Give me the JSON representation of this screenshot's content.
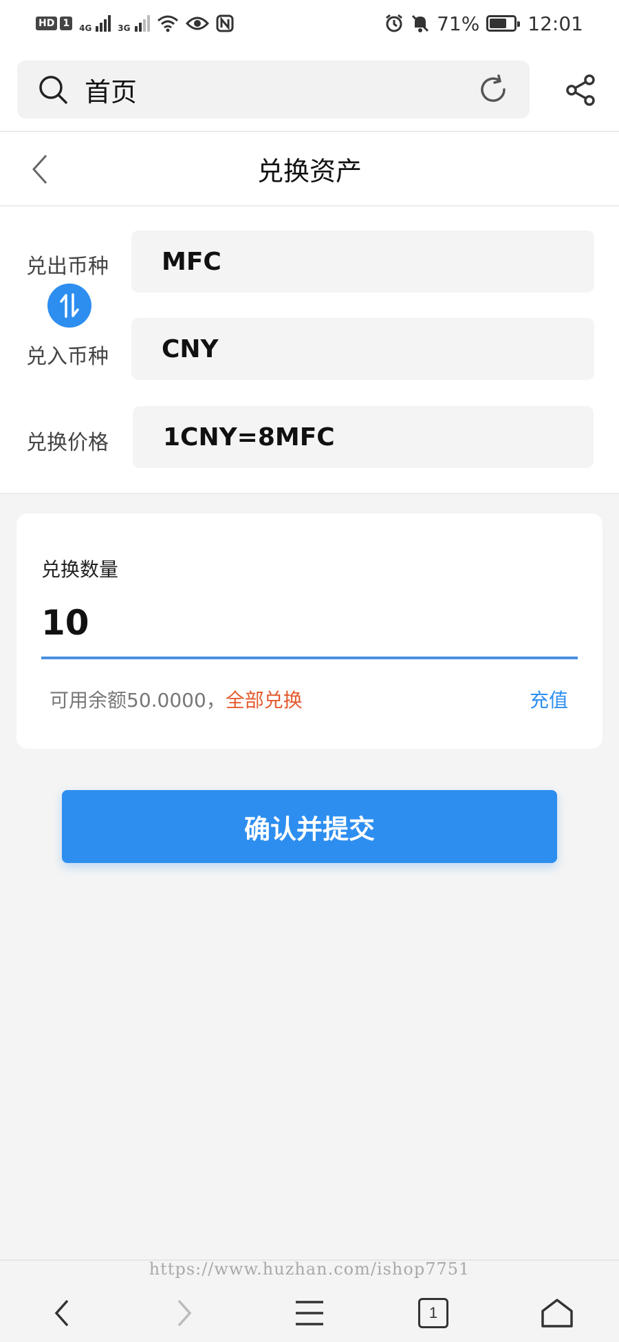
{
  "status_bar": {
    "hd_badge": "HD",
    "sim_badge": "1",
    "net1": "4G",
    "net2": "3G",
    "battery_percent": "71%",
    "battery_level": 0.71,
    "time": "12:01",
    "icons": [
      "wifi-icon",
      "eye-icon",
      "nfc-icon",
      "alarm-icon",
      "mute-icon",
      "battery-icon"
    ]
  },
  "browser": {
    "url_text": "首页",
    "icons": [
      "search-icon",
      "refresh-icon",
      "share-icon"
    ]
  },
  "header": {
    "title": "兑换资产"
  },
  "currency": {
    "from_label": "兑出币种",
    "from_value": "MFC",
    "to_label": "兑入币种",
    "to_value": "CNY",
    "price_label": "兑换价格",
    "price_value": "1CNY=8MFC"
  },
  "amount": {
    "label": "兑换数量",
    "value": "10",
    "available_text": "可用余额50.0000，",
    "all_link": "全部兑换",
    "recharge_link": "充值"
  },
  "submit_label": "确认并提交",
  "bottom_nav": {
    "tab_count": "1",
    "watermark": "https://www.huzhan.com/ishop7751"
  },
  "colors": {
    "primary": "#2d8ef0",
    "link_orange": "#e35b2f",
    "underline": "#4a8fe0",
    "background": "#f4f4f4"
  }
}
